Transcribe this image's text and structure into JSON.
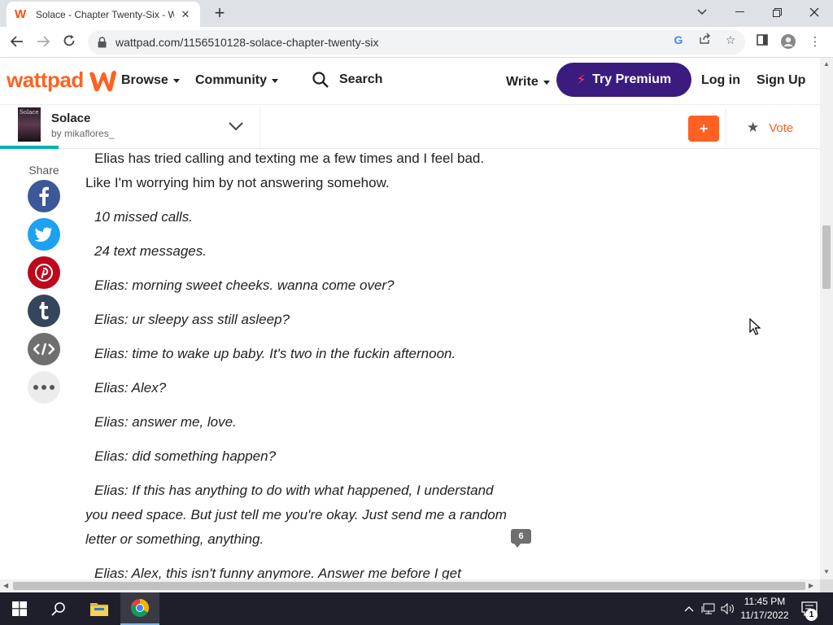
{
  "browser": {
    "tab_title": "Solace - Chapter Twenty-Six - Wa",
    "url": "wattpad.com/1156510128-solace-chapter-twenty-six",
    "icons": [
      "close-icon",
      "plus-icon",
      "back-icon",
      "forward-icon",
      "reload-icon",
      "lock-icon",
      "google-icon",
      "share-icon",
      "star-icon",
      "sidepanel-icon",
      "profile-icon",
      "menu-icon"
    ]
  },
  "header": {
    "logo": "wattpad",
    "browse": "Browse",
    "community": "Community",
    "search": "Search",
    "write": "Write",
    "premium": "Try Premium",
    "login": "Log in",
    "signup": "Sign Up"
  },
  "story_bar": {
    "title": "Solace",
    "author": "by mikaflores_",
    "cover_text": "Solace",
    "add": "+",
    "vote": "Vote"
  },
  "share": {
    "label": "Share",
    "networks": [
      "facebook",
      "twitter",
      "pinterest",
      "tumblr",
      "embed",
      "more"
    ]
  },
  "story": {
    "paragraphs": [
      "Elias has tried calling and texting me a few times and I feel bad. Like I'm worrying him by not answering somehow.",
      "10 missed calls.",
      "24 text messages.",
      "Elias: morning sweet cheeks. wanna come over?",
      "Elias: ur sleepy ass still asleep?",
      "Elias: time to wake up baby. It's two in the fuckin afternoon.",
      "Elias: Alex?",
      "Elias: answer me, love.",
      "Elias: did something happen?",
      "Elias: If this has anything to do with what happened, I understand you need space. But just tell me you're okay. Just send me a random letter or something, anything.",
      "Elias: Alex, this isn't funny anymore. Answer me before I get worried"
    ],
    "comment_count": "6"
  },
  "taskbar": {
    "time": "11:45 PM",
    "date": "11/17/2022",
    "notifications": "1"
  },
  "colors": {
    "brand": "#ff6122",
    "premium": "#3b1c7e",
    "progress": "#00b2b2"
  }
}
